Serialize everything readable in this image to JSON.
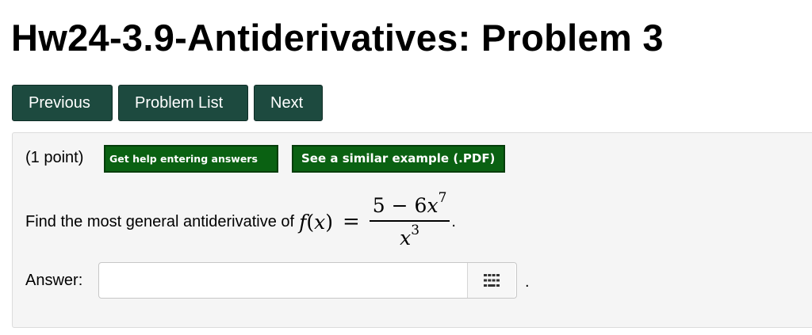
{
  "title": "Hw24-3.9-Antiderivatives: Problem 3",
  "nav": {
    "previous": "Previous",
    "problem_list": "Problem List",
    "next": "Next"
  },
  "problem": {
    "points": "(1 point)",
    "help_entering": "Get help entering answers",
    "similar_example": "See a similar example (.PDF)",
    "question_text": "Find the most general antiderivative of",
    "math": {
      "function_name": "f",
      "variable": "x",
      "numerator_constant": "5",
      "minus": "−",
      "coefficient": "6",
      "numerator_exponent": "7",
      "denominator_exponent": "3"
    },
    "answer_label": "Answer:",
    "answer_value": "",
    "trailing_period": "."
  },
  "icons": {
    "palette": "grid-keypad-icon"
  },
  "colors": {
    "nav_button": "#1d4a3f",
    "help_button": "#0a6112",
    "panel_background": "#f5f5f5"
  }
}
